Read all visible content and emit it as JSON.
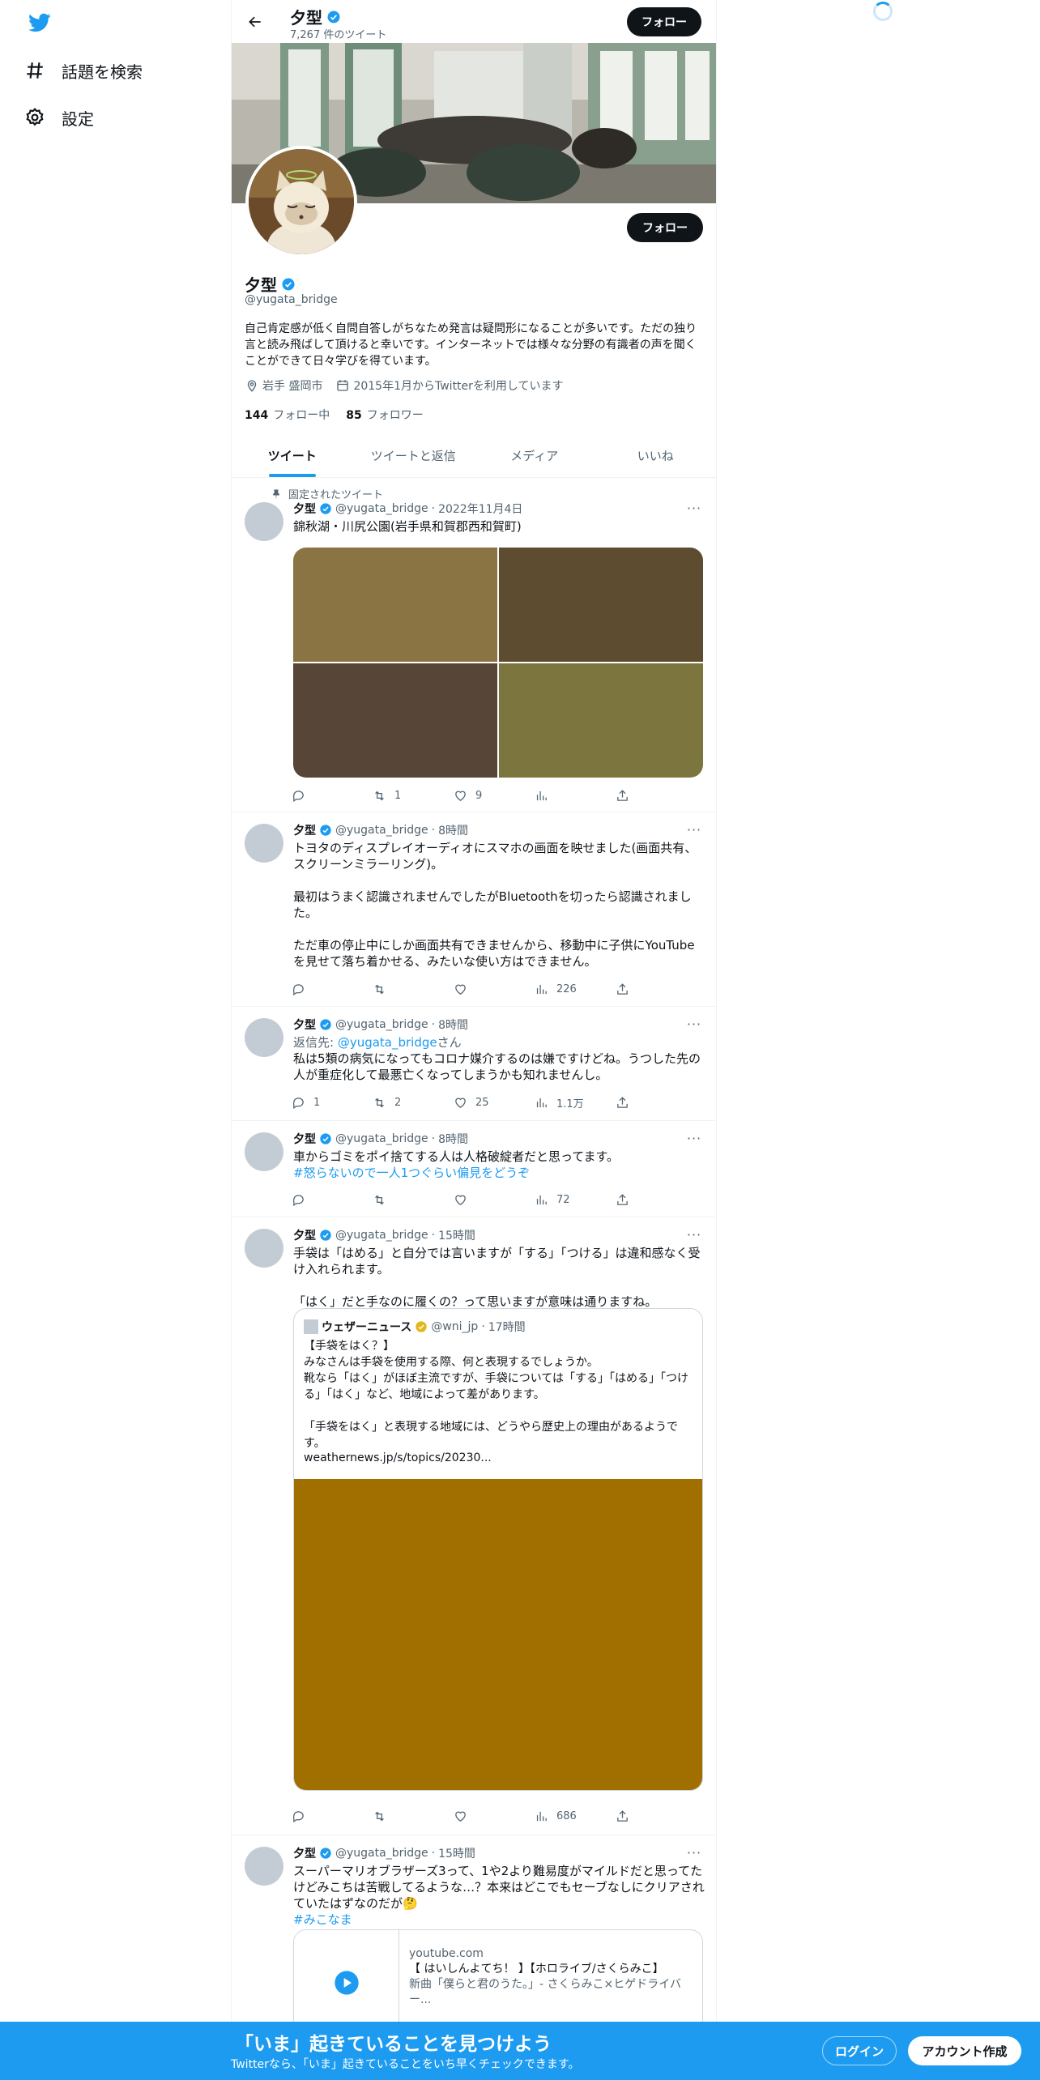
{
  "sidebar": {
    "items": [
      {
        "label": "話題を検索",
        "icon": "hashtag-icon"
      },
      {
        "label": "設定",
        "icon": "gear-icon"
      }
    ]
  },
  "header": {
    "name": "夕型",
    "tweet_count": "7,267 件のツイート",
    "follow_label": "フォロー"
  },
  "profile": {
    "name": "夕型",
    "handle": "@yugata_bridge",
    "follow_label": "フォロー",
    "bio": "自己肯定感が低く自問自答しがちなため発言は疑問形になることが多いです。ただの独り言と読み飛ばして頂けると幸いです。インターネットでは様々な分野の有識者の声を聞くことができて日々学びを得ています。",
    "location": "岩手 盛岡市",
    "joined": "2015年1月からTwitterを利用しています",
    "following_count": "144",
    "following_label": "フォロー中",
    "followers_count": "85",
    "followers_label": "フォロワー"
  },
  "tabs": [
    {
      "label": "ツイート"
    },
    {
      "label": "ツイートと返信"
    },
    {
      "label": "メディア"
    },
    {
      "label": "いいね"
    }
  ],
  "tweets": [
    {
      "pinned_label": "固定されたツイート",
      "name": "夕型",
      "handle": "@yugata_bridge",
      "time": "2022年11月4日",
      "text": "錦秋湖・川尻公園(岩手県和賀郡西和賀町)",
      "images": [
        "#8a7443",
        "#5e4c30",
        "#574537",
        "#7c763e"
      ],
      "reply": "",
      "retweet": "1",
      "like": "9",
      "views": ""
    },
    {
      "name": "夕型",
      "handle": "@yugata_bridge",
      "time": "8時間",
      "text": "トヨタのディスプレイオーディオにスマホの画面を映せました(画面共有、スクリーンミラーリング)。\n\n最初はうまく認識されませんでしたがBluetoothを切ったら認識されました。\n\nただ車の停止中にしか画面共有できませんから、移動中に子供にYouTubeを見せて落ち着かせる、みたいな使い方はできません。",
      "reply": "",
      "retweet": "",
      "like": "",
      "views": "226"
    },
    {
      "name": "夕型",
      "handle": "@yugata_bridge",
      "time": "8時間",
      "reply_to_prefix": "返信先: ",
      "reply_to_handle": "@yugata_bridge",
      "reply_to_suffix": "さん",
      "text": "私は5類の病気になってもコロナ媒介するのは嫌ですけどね。うつした先の人が重症化して最悪亡くなってしまうかも知れませんし。",
      "reply": "1",
      "retweet": "2",
      "like": "25",
      "views": "1.1万"
    },
    {
      "name": "夕型",
      "handle": "@yugata_bridge",
      "time": "8時間",
      "text": "車からゴミをポイ捨てする人は人格破綻者だと思ってます。",
      "hashtag": "#怒らないので一人1つぐらい偏見をどうぞ",
      "reply": "",
      "retweet": "",
      "like": "",
      "views": "72"
    },
    {
      "name": "夕型",
      "handle": "@yugata_bridge",
      "time": "15時間",
      "text": "手袋は「はめる」と自分では言いますが「する」「つける」は違和感なく受け入れられます。\n\n「はく」だと手なのに履くの？って思いますが意味は通りますね。",
      "quote": {
        "name": "ウェザーニュース",
        "handle": "@wni_jp",
        "time": "17時間",
        "text": "【手袋をはく？】\nみなさんは手袋を使用する際、何と表現するでしょうか。\n靴なら「はく」がほぼ主流ですが、手袋については「する」「はめる」「つける」「はく」など、地域によって差があります。\n\n「手袋をはく」と表現する地域には、どうやら歴史上の理由があるようです。",
        "link": "weathernews.jp/s/topics/20230...",
        "image_color": "#a06f00"
      },
      "reply": "",
      "retweet": "",
      "like": "",
      "views": "686"
    },
    {
      "name": "夕型",
      "handle": "@yugata_bridge",
      "time": "15時間",
      "text": "スーパーマリオブラザーズ3って、1や2より難易度がマイルドだと思ってたけどみこちは苦戦してるような…？本来はどこでもセーブなしにクリアされていたはずなのだが🤔",
      "hashtag": "#みこなま",
      "card": {
        "domain": "youtube.com",
        "title": "【 はいしんよてち！ 】【ホロライブ/さくらみこ】",
        "description": "新曲「僕らと君のうた。」- さくらみこ×ヒゲドライバー..."
      }
    }
  ],
  "bottom_bar": {
    "title": "「いま」起きていることを見つけよう",
    "subtitle": "Twitterなら、「いま」起きていることをいち早くチェックできます。",
    "login_label": "ログイン",
    "signup_label": "アカウント作成"
  },
  "colors": {
    "accent": "#1d9bf0",
    "text": "#0f1419",
    "muted": "#536471"
  }
}
